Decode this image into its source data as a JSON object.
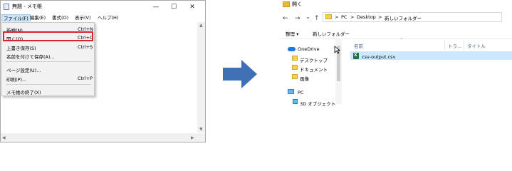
{
  "notepad": {
    "title": "無題 - メモ帳",
    "window_controls": {
      "minimize": "—",
      "maximize": "☐",
      "close": "✕"
    },
    "menu": [
      "ファイル(F)",
      "編集(E)",
      "書式(O)",
      "表示(V)",
      "ヘルプ(H)"
    ],
    "file_menu": {
      "items": [
        {
          "label": "新規(N)",
          "shortcut": "Ctrl+N"
        },
        {
          "label": "開く(O)...",
          "shortcut": "Ctrl+O"
        },
        {
          "label": "上書き保存(S)",
          "shortcut": "Ctrl+S"
        },
        {
          "label": "名前を付けて保存(A)...",
          "shortcut": ""
        },
        {
          "label": "ページ設定(U)...",
          "shortcut": ""
        },
        {
          "label": "印刷(P)...",
          "shortcut": "Ctrl+P"
        },
        {
          "label": "メモ帳の終了(X)",
          "shortcut": ""
        }
      ],
      "highlighted_item": "開く(O)...",
      "highlight_color": "#d6262b"
    }
  },
  "arrow": {
    "color": "#3f6fb5"
  },
  "explorer": {
    "title": "開く",
    "nav_buttons": {
      "back": "←",
      "forward": "→",
      "recent": "⌄",
      "up": "↑"
    },
    "breadcrumb": [
      "PC",
      "Desktop",
      "新しいフォルダー"
    ],
    "breadcrumb_separator": ">",
    "toolbar": {
      "organize": "整理 ▾",
      "new_folder": "新しいフォルダー"
    },
    "tree": [
      {
        "label": "OneDrive",
        "icon": "onedrive-icon"
      },
      {
        "label": "デスクトップ",
        "icon": "folder-icon"
      },
      {
        "label": "ドキュメント",
        "icon": "folder-icon"
      },
      {
        "label": "画像",
        "icon": "folder-icon"
      },
      {
        "label": "PC",
        "icon": "pc-icon"
      },
      {
        "label": "3D オブジェクト",
        "icon": "3d-objects-icon"
      }
    ],
    "columns": [
      "名前",
      "トラ...",
      "タイトル"
    ],
    "files": [
      {
        "name": "csv-output.csv",
        "icon": "excel-csv-icon",
        "selected": true
      }
    ]
  }
}
